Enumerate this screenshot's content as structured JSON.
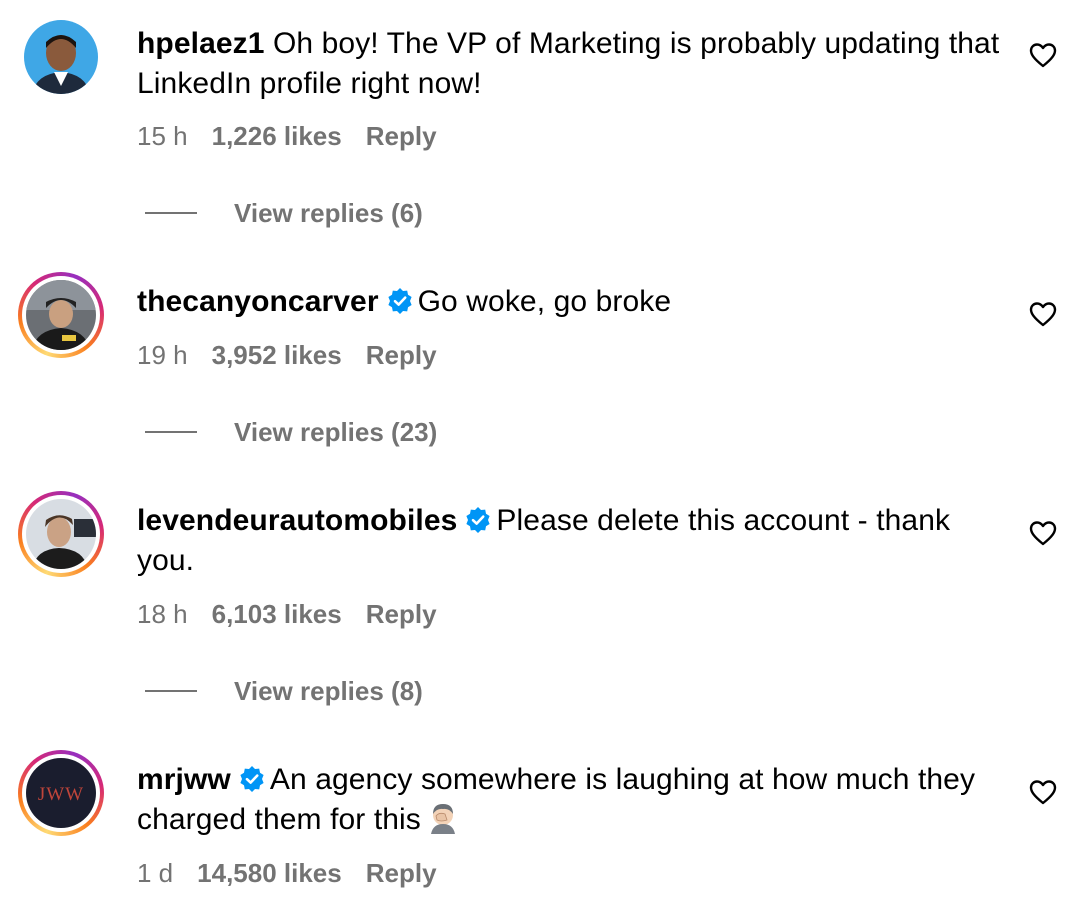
{
  "comments": [
    {
      "username": "hpelaez1",
      "verified": false,
      "text": "Oh boy! The VP of Marketing is probably updating that LinkedIn profile right now!",
      "time": "15 h",
      "likes": "1,226 likes",
      "reply": "Reply",
      "view_replies": "View replies (6)"
    },
    {
      "username": "thecanyoncarver",
      "verified": true,
      "text": "Go woke, go broke",
      "time": "19 h",
      "likes": "3,952 likes",
      "reply": "Reply",
      "view_replies": "View replies (23)"
    },
    {
      "username": "levendeurautomobiles",
      "verified": true,
      "text": "Please delete this account - thank you.",
      "time": "18 h",
      "likes": "6,103 likes",
      "reply": "Reply",
      "view_replies": "View replies (8)"
    },
    {
      "username": "mrjww",
      "verified": true,
      "text": "An agency somewhere is laughing at how much they charged them for this",
      "time": "1 d",
      "likes": "14,580 likes",
      "reply": "Reply",
      "avatar_text": "JWW"
    }
  ],
  "icons": {
    "verified": "verified-badge-icon",
    "heart": "heart-outline-icon",
    "emoji": "man-facepalming-emoji"
  },
  "colors": {
    "verified_blue": "#0095f6",
    "secondary_text": "#737373"
  }
}
